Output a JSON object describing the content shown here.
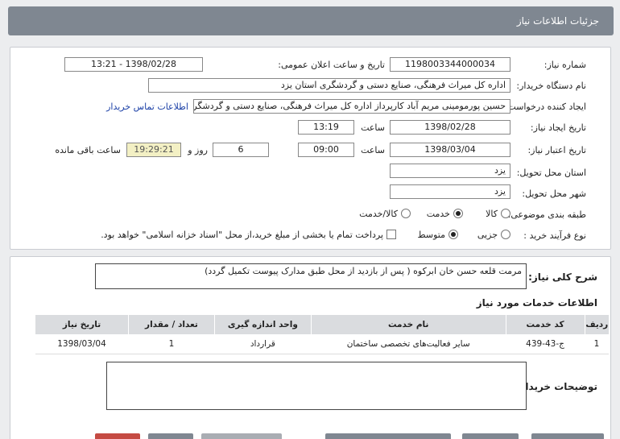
{
  "header": {
    "title": "جزئیات اطلاعات نیاز"
  },
  "form": {
    "need_number_label": "شماره نیاز:",
    "need_number": "1198003344000034",
    "announce_label": "تاریخ و ساعت اعلان عمومی:",
    "announce_value": "1398/02/28 - 13:21",
    "buyer_org_label": "نام دستگاه خریدار:",
    "buyer_org": "اداره کل میراث فرهنگی، صنایع دستی و گردشگری استان یزد",
    "requester_label": "ایجاد کننده درخواست:",
    "requester": "حسین پورمومینی مریم آباد کارپرداز اداره کل میراث فرهنگی، صنایع دستی و گردشگری استان یزد",
    "contact_link": "اطلاعات تماس خریدار",
    "created_label": "تاریخ ایجاد نیاز:",
    "created_date": "1398/02/28",
    "time_label": "ساعت",
    "created_time": "13:19",
    "validity_label": "تاریخ اعتبار نیاز:",
    "validity_date": "1398/03/04",
    "validity_time": "09:00",
    "days": "6",
    "days_label": "روز و",
    "remaining": "19:29:21",
    "remaining_label": "ساعت باقی مانده",
    "province_label": "استان محل تحویل:",
    "province": "یزد",
    "city_label": "شهر محل تحویل:",
    "city": "یزد",
    "category_label": "طبقه بندی موضوعی:",
    "cat_goods": "کالا",
    "cat_service": "خدمت",
    "cat_both": "کالا/خدمت",
    "process_label": "نوع فرآیند خرید :",
    "proc_minor": "جزیی",
    "proc_medium": "متوسط",
    "payment_note": "پرداخت تمام یا بخشی از مبلغ خرید،از محل \"اسناد خزانه اسلامی\" خواهد بود."
  },
  "details": {
    "summary_label": "شرح کلی نیاز:",
    "summary": "مرمت قلعه حسن خان ابرکوه ( پس از بازدید از محل طبق مدارک پیوست تکمیل گردد)",
    "services_title": "اطلاعات خدمات مورد نیاز",
    "columns": [
      "ردیف",
      "کد خدمت",
      "نام خدمت",
      "واحد اندازه گیری",
      "تعداد / مقدار",
      "تاریخ نیاز"
    ],
    "rows": [
      [
        "1",
        "ج-43-439",
        "سایر فعالیت‌های تخصصی ساختمان",
        "قرارداد",
        "1",
        "1398/03/04"
      ]
    ],
    "buyer_notes_label": "توضیحات خریدار:"
  }
}
